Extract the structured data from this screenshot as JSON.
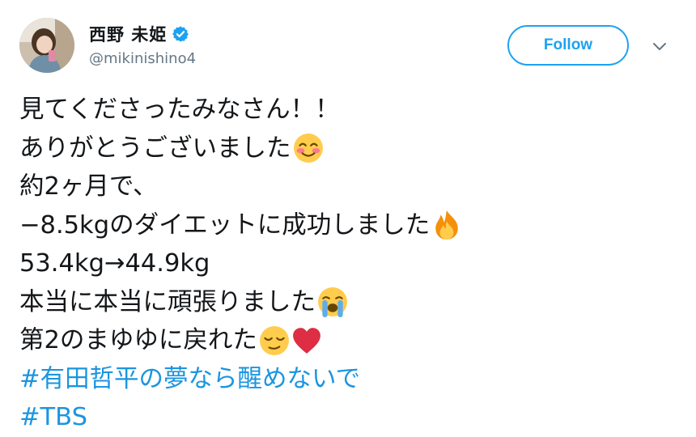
{
  "user": {
    "display_name": "西野 未姫",
    "handle": "@mikinishino4",
    "verified_icon": "verified-badge-icon",
    "accent_color": "#1da1f2"
  },
  "actions": {
    "follow_label": "Follow",
    "more_icon": "chevron-down-icon"
  },
  "tweet": {
    "lines": [
      {
        "text": "見てくださったみなさん！！"
      },
      {
        "text": "ありがとうございました",
        "emoji": "smiling-face-with-smiling-eyes-emoji"
      },
      {
        "text": "約2ヶ月で、"
      },
      {
        "text": "−8.5kgのダイエットに成功しました",
        "emoji": "fire-emoji"
      },
      {
        "text": "53.4kg→44.9kg"
      },
      {
        "text": "本当に本当に頑張りました",
        "emoji": "loudly-crying-face-emoji"
      },
      {
        "text": "第2のまゆゆに戻れた",
        "emoji": "relieved-face-emoji",
        "emoji2": "red-heart-emoji"
      }
    ],
    "hashtags": [
      "#有田哲平の夢なら醒めないで",
      "#TBS"
    ],
    "hashtag_color": "#1b95e0"
  }
}
